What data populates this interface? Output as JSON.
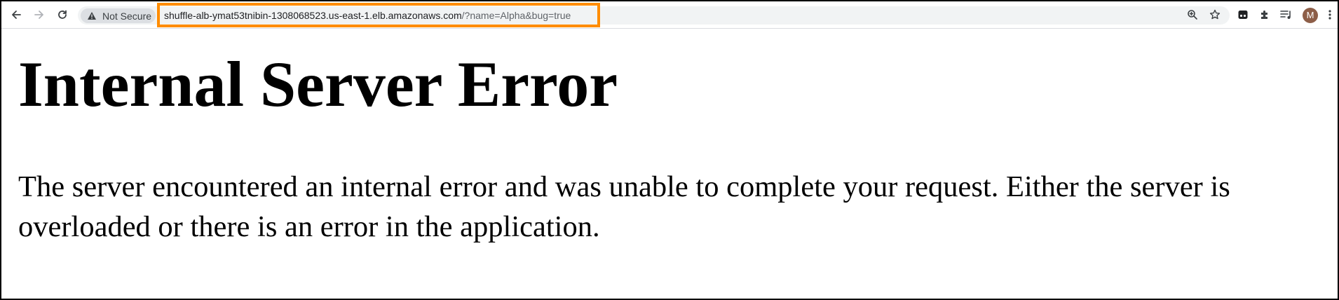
{
  "browser": {
    "security_label": "Not Secure",
    "url_host": "shuffle-alb-ymat53tnibin-1308068523.us-east-1.elb.amazonaws.com",
    "url_path": "/?name=Alpha&bug=true",
    "profile_initial": "M",
    "highlight_color": "#ff8c00",
    "icons": [
      "back-icon",
      "forward-icon",
      "reload-icon",
      "warning-icon",
      "zoom-icon",
      "star-icon",
      "extension-icon",
      "puzzle-icon",
      "reading-list-icon",
      "menu-icon"
    ]
  },
  "page": {
    "heading": "Internal Server Error",
    "message": "The server encountered an internal error and was unable to complete your request. Either the server is overloaded or there is an error in the application."
  }
}
